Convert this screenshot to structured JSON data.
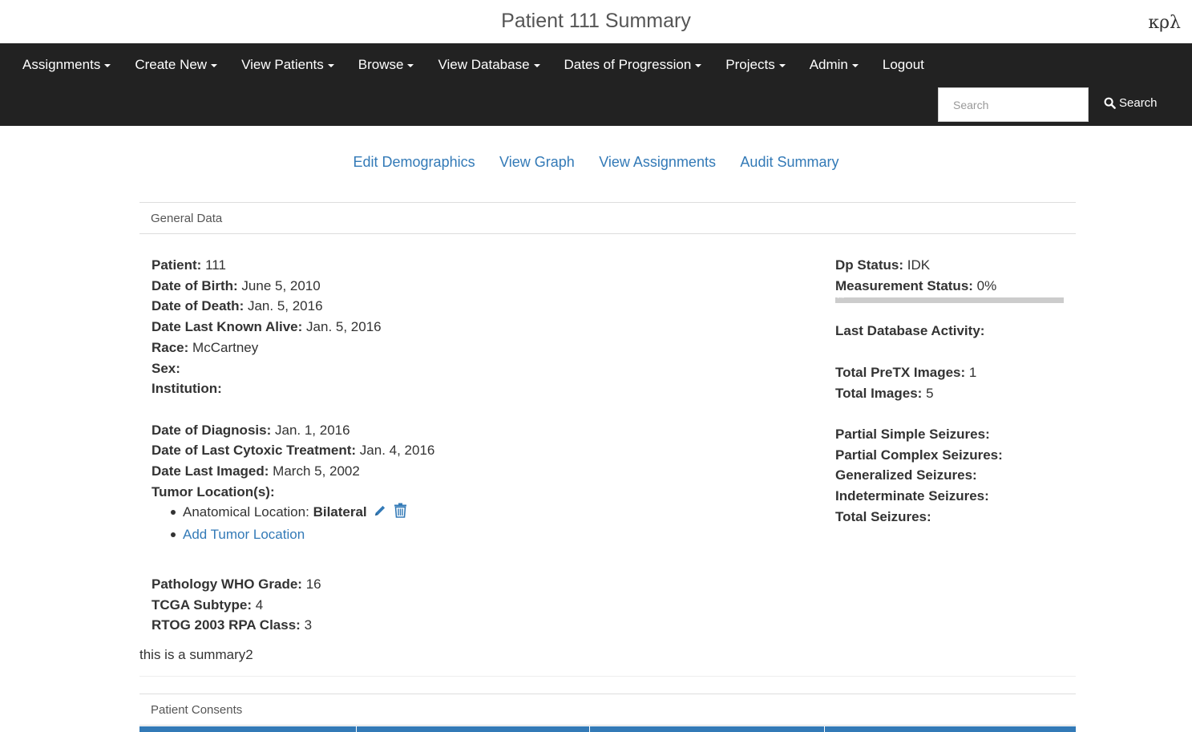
{
  "header": {
    "title": "Patient 111 Summary",
    "brand": "κρλ"
  },
  "nav": {
    "items": [
      {
        "label": "Assignments",
        "dropdown": true
      },
      {
        "label": "Create New",
        "dropdown": true
      },
      {
        "label": "View Patients",
        "dropdown": true
      },
      {
        "label": "Browse",
        "dropdown": true
      },
      {
        "label": "View Database",
        "dropdown": true
      },
      {
        "label": "Dates of Progression",
        "dropdown": true
      },
      {
        "label": "Projects",
        "dropdown": true
      },
      {
        "label": "Admin",
        "dropdown": true
      },
      {
        "label": "Logout",
        "dropdown": false
      }
    ],
    "search_placeholder": "Search",
    "search_button": "Search"
  },
  "subnav": {
    "links": [
      "Edit Demographics",
      "View Graph",
      "View Assignments",
      "Audit Summary"
    ]
  },
  "general": {
    "heading": "General Data",
    "patient_label": "Patient:",
    "patient": "111",
    "dob_label": "Date of Birth:",
    "dob": "June 5, 2010",
    "dod_label": "Date of Death:",
    "dod": "Jan. 5, 2016",
    "alive_label": "Date Last Known Alive:",
    "alive": "Jan. 5, 2016",
    "race_label": "Race:",
    "race": "McCartney",
    "sex_label": "Sex:",
    "sex": "",
    "institution_label": "Institution:",
    "institution": "",
    "diagnosis_label": "Date of Diagnosis:",
    "diagnosis": "Jan. 1, 2016",
    "cytoxic_label": "Date of Last Cytoxic Treatment:",
    "cytoxic": "Jan. 4, 2016",
    "imaged_label": "Date Last Imaged:",
    "imaged": "March 5, 2002",
    "tumor_label": "Tumor Location(s):",
    "tumor_item_prefix": "Anatomical Location:",
    "tumor_item_value": "Bilateral",
    "add_tumor": "Add Tumor Location",
    "who_label": "Pathology WHO Grade:",
    "who": "16",
    "tcga_label": "TCGA Subtype:",
    "tcga": "4",
    "rtog_label": "RTOG 2003 RPA Class:",
    "rtog": "3",
    "summary": "this is a summary2"
  },
  "right": {
    "dp_label": "Dp Status:",
    "dp": "IDK",
    "measure_label": "Measurement Status:",
    "measure": "0%",
    "progress_value": 0,
    "progress_text": "0%",
    "activity_label": "Last Database Activity:",
    "pretx_label": "Total PreTX Images:",
    "pretx": "1",
    "images_label": "Total Images:",
    "images": "5",
    "pss_label": "Partial Simple Seizures:",
    "pcs_label": "Partial Complex Seizures:",
    "gs_label": "Generalized Seizures:",
    "is_label": "Indeterminate Seizures:",
    "ts_label": "Total Seizures:"
  },
  "consents": {
    "heading": "Patient Consents"
  },
  "colors": {
    "navbar": "#222222",
    "link": "#337ab7",
    "progress_track": "#cccccc"
  }
}
